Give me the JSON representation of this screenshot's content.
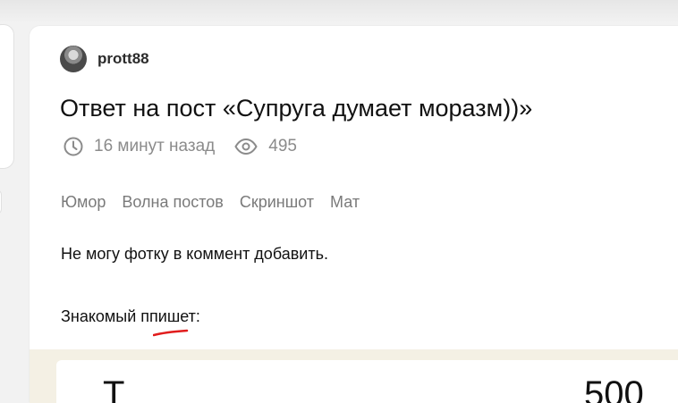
{
  "post": {
    "author": "prott88",
    "title": "Ответ на пост «Супруга думает моразм))»",
    "time_ago": "16 минут назад",
    "views": "495",
    "tags": [
      "Юмор",
      "Волна постов",
      "Скриншот",
      "Мат"
    ],
    "body": [
      "Не могу фотку в коммент добавить.",
      "Знакомый ппишет:"
    ]
  },
  "embedded_image": {
    "partial_text": "T",
    "partial_number": "500"
  },
  "icons": {
    "clock": "clock-icon",
    "views": "eye-icon",
    "avatar": "user-avatar"
  },
  "colors": {
    "meta_gray": "#8b8b8b",
    "tag_gray": "#7a7a7a",
    "annotation_red": "#e11d1d"
  }
}
